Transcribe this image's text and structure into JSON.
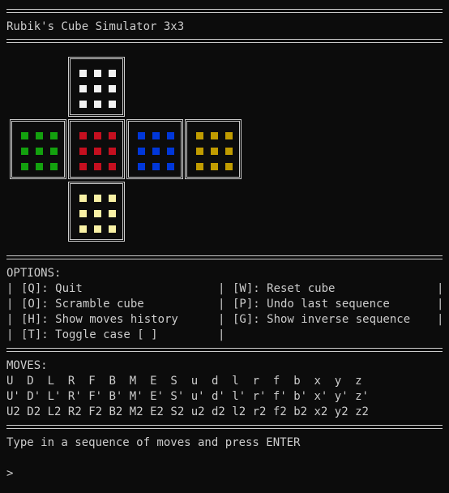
{
  "title": "Rubik's Cube Simulator 3x3",
  "colors": {
    "white": "#f2f2f2",
    "red": "#c50f1f",
    "blue": "#0037da",
    "orange": "#c19c00",
    "green": "#13a10e",
    "yellow": "#f9f1a5"
  },
  "cube": {
    "up": "white",
    "left": "green",
    "front": "red",
    "right": "blue",
    "back": "orange",
    "down": "yellow"
  },
  "options": {
    "heading": "OPTIONS:",
    "left": [
      "[Q]: Quit",
      "[O]: Scramble cube",
      "[H]: Show moves history",
      "[T]: Toggle case [ ]"
    ],
    "right": [
      "[W]: Reset cube",
      "[P]: Undo last sequence",
      "[G]: Show inverse sequence",
      ""
    ]
  },
  "moves": {
    "heading": "MOVES:",
    "rows": [
      [
        "U",
        "D",
        "L",
        "R",
        "F",
        "B",
        "M",
        "E",
        "S",
        "u",
        "d",
        "l",
        "r",
        "f",
        "b",
        "x",
        "y",
        "z"
      ],
      [
        "U'",
        "D'",
        "L'",
        "R'",
        "F'",
        "B'",
        "M'",
        "E'",
        "S'",
        "u'",
        "d'",
        "l'",
        "r'",
        "f'",
        "b'",
        "x'",
        "y'",
        "z'"
      ],
      [
        "U2",
        "D2",
        "L2",
        "R2",
        "F2",
        "B2",
        "M2",
        "E2",
        "S2",
        "u2",
        "d2",
        "l2",
        "r2",
        "f2",
        "b2",
        "x2",
        "y2",
        "z2"
      ]
    ]
  },
  "prompt": {
    "instruction": "Type in a sequence of moves and press ENTER",
    "cursor": ">"
  }
}
